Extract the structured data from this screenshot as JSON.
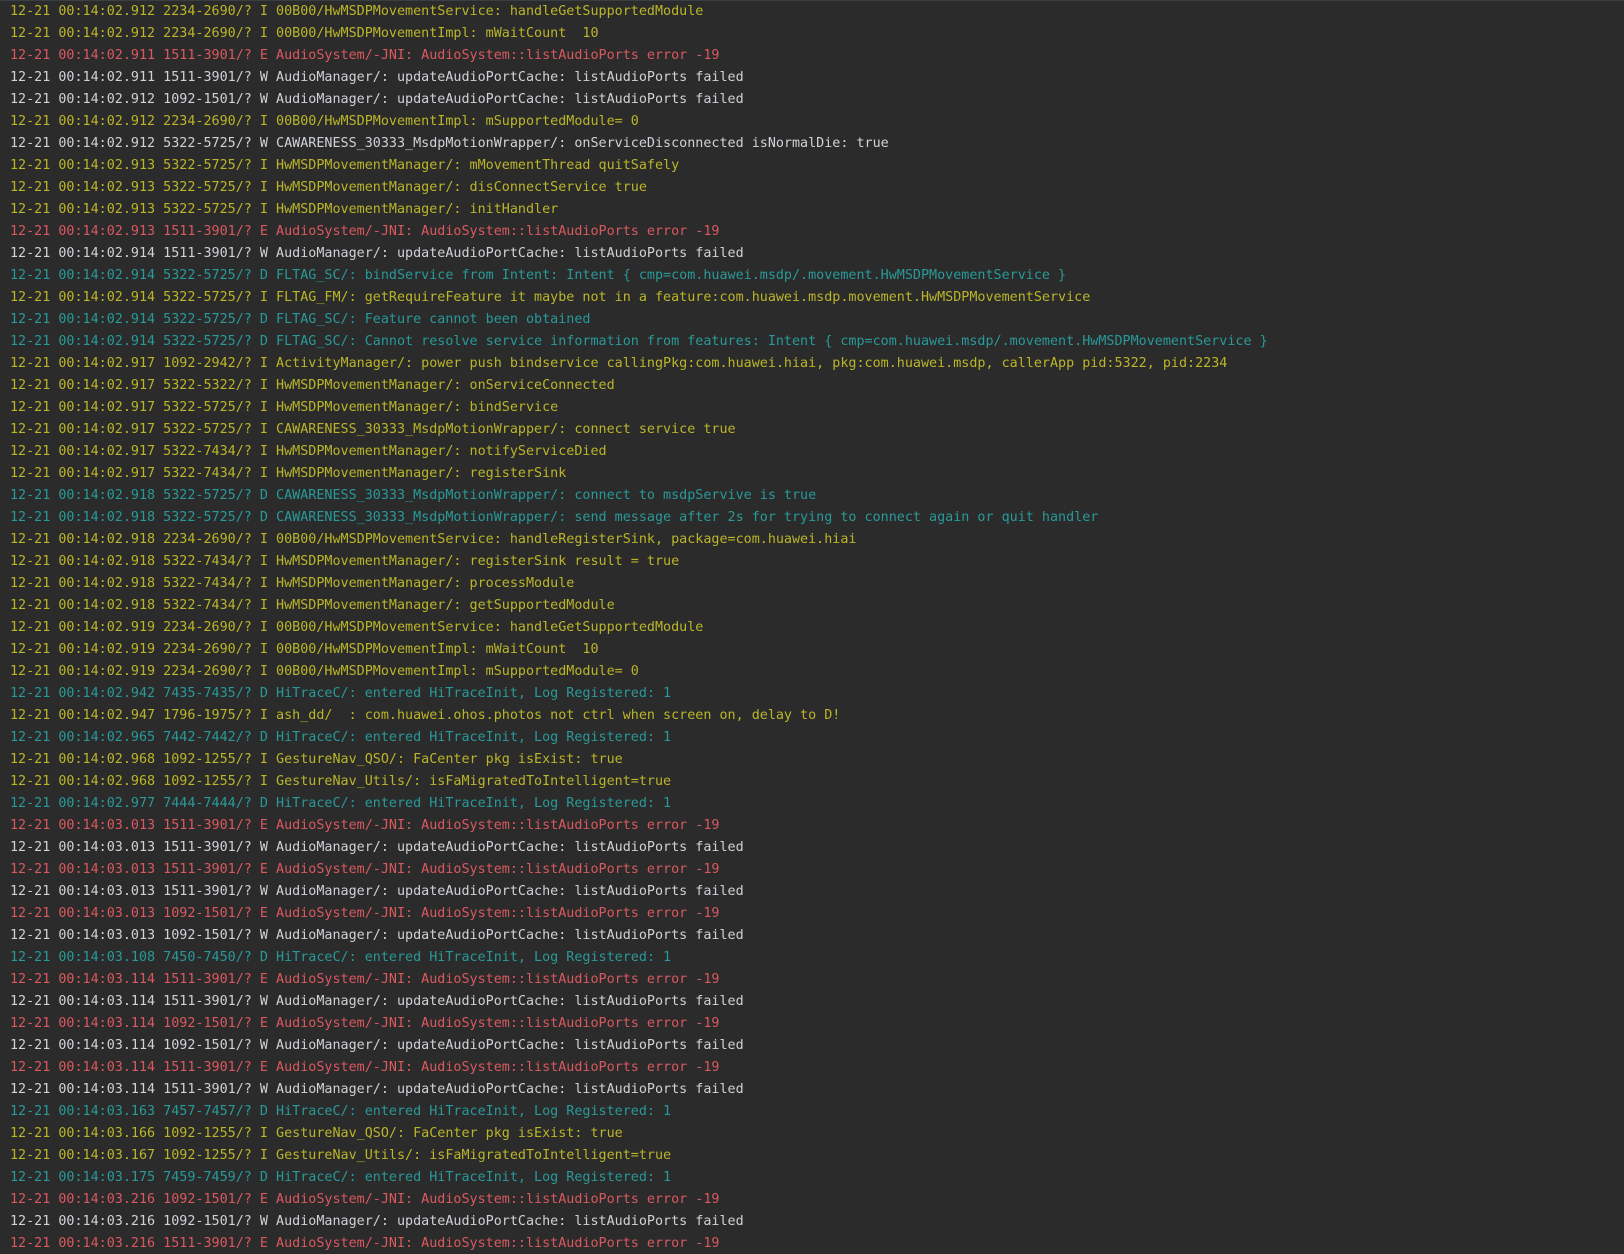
{
  "log": {
    "colors": {
      "I": "#bbb529",
      "E": "#d9595f",
      "W": "#cfd2d6",
      "D": "#299999",
      "background": "#2b2b2b"
    },
    "lines": [
      {
        "level": "I",
        "text": "12-21 00:14:02.912 2234-2690/? I 00B00/HwMSDPMovementService: handleGetSupportedModule"
      },
      {
        "level": "I",
        "text": "12-21 00:14:02.912 2234-2690/? I 00B00/HwMSDPMovementImpl: mWaitCount  10"
      },
      {
        "level": "E",
        "text": "12-21 00:14:02.911 1511-3901/? E AudioSystem/-JNI: AudioSystem::listAudioPorts error -19"
      },
      {
        "level": "W",
        "text": "12-21 00:14:02.911 1511-3901/? W AudioManager/: updateAudioPortCache: listAudioPorts failed"
      },
      {
        "level": "W",
        "text": "12-21 00:14:02.912 1092-1501/? W AudioManager/: updateAudioPortCache: listAudioPorts failed"
      },
      {
        "level": "I",
        "text": "12-21 00:14:02.912 2234-2690/? I 00B00/HwMSDPMovementImpl: mSupportedModule= 0"
      },
      {
        "level": "W",
        "text": "12-21 00:14:02.912 5322-5725/? W CAWARENESS_30333_MsdpMotionWrapper/: onServiceDisconnected isNormalDie: true"
      },
      {
        "level": "I",
        "text": "12-21 00:14:02.913 5322-5725/? I HwMSDPMovementManager/: mMovementThread quitSafely"
      },
      {
        "level": "I",
        "text": "12-21 00:14:02.913 5322-5725/? I HwMSDPMovementManager/: disConnectService true"
      },
      {
        "level": "I",
        "text": "12-21 00:14:02.913 5322-5725/? I HwMSDPMovementManager/: initHandler"
      },
      {
        "level": "E",
        "text": "12-21 00:14:02.913 1511-3901/? E AudioSystem/-JNI: AudioSystem::listAudioPorts error -19"
      },
      {
        "level": "W",
        "text": "12-21 00:14:02.914 1511-3901/? W AudioManager/: updateAudioPortCache: listAudioPorts failed"
      },
      {
        "level": "D",
        "text": "12-21 00:14:02.914 5322-5725/? D FLTAG_SC/: bindService from Intent: Intent { cmp=com.huawei.msdp/.movement.HwMSDPMovementService }"
      },
      {
        "level": "I",
        "text": "12-21 00:14:02.914 5322-5725/? I FLTAG_FM/: getRequireFeature it maybe not in a feature:com.huawei.msdp.movement.HwMSDPMovementService"
      },
      {
        "level": "D",
        "text": "12-21 00:14:02.914 5322-5725/? D FLTAG_SC/: Feature cannot been obtained"
      },
      {
        "level": "D",
        "text": "12-21 00:14:02.914 5322-5725/? D FLTAG_SC/: Cannot resolve service information from features: Intent { cmp=com.huawei.msdp/.movement.HwMSDPMovementService }"
      },
      {
        "level": "I",
        "text": "12-21 00:14:02.917 1092-2942/? I ActivityManager/: power push bindservice callingPkg:com.huawei.hiai, pkg:com.huawei.msdp, callerApp pid:5322, pid:2234"
      },
      {
        "level": "I",
        "text": "12-21 00:14:02.917 5322-5322/? I HwMSDPMovementManager/: onServiceConnected"
      },
      {
        "level": "I",
        "text": "12-21 00:14:02.917 5322-5725/? I HwMSDPMovementManager/: bindService"
      },
      {
        "level": "I",
        "text": "12-21 00:14:02.917 5322-5725/? I CAWARENESS_30333_MsdpMotionWrapper/: connect service true"
      },
      {
        "level": "I",
        "text": "12-21 00:14:02.917 5322-7434/? I HwMSDPMovementManager/: notifyServiceDied"
      },
      {
        "level": "I",
        "text": "12-21 00:14:02.917 5322-7434/? I HwMSDPMovementManager/: registerSink"
      },
      {
        "level": "D",
        "text": "12-21 00:14:02.918 5322-5725/? D CAWARENESS_30333_MsdpMotionWrapper/: connect to msdpServive is true"
      },
      {
        "level": "D",
        "text": "12-21 00:14:02.918 5322-5725/? D CAWARENESS_30333_MsdpMotionWrapper/: send message after 2s for trying to connect again or quit handler"
      },
      {
        "level": "I",
        "text": "12-21 00:14:02.918 2234-2690/? I 00B00/HwMSDPMovementService: handleRegisterSink, package=com.huawei.hiai"
      },
      {
        "level": "I",
        "text": "12-21 00:14:02.918 5322-7434/? I HwMSDPMovementManager/: registerSink result = true"
      },
      {
        "level": "I",
        "text": "12-21 00:14:02.918 5322-7434/? I HwMSDPMovementManager/: processModule"
      },
      {
        "level": "I",
        "text": "12-21 00:14:02.918 5322-7434/? I HwMSDPMovementManager/: getSupportedModule"
      },
      {
        "level": "I",
        "text": "12-21 00:14:02.919 2234-2690/? I 00B00/HwMSDPMovementService: handleGetSupportedModule"
      },
      {
        "level": "I",
        "text": "12-21 00:14:02.919 2234-2690/? I 00B00/HwMSDPMovementImpl: mWaitCount  10"
      },
      {
        "level": "I",
        "text": "12-21 00:14:02.919 2234-2690/? I 00B00/HwMSDPMovementImpl: mSupportedModule= 0"
      },
      {
        "level": "D",
        "text": "12-21 00:14:02.942 7435-7435/? D HiTraceC/: entered HiTraceInit, Log Registered: 1"
      },
      {
        "level": "I",
        "text": "12-21 00:14:02.947 1796-1975/? I ash_dd/  : com.huawei.ohos.photos not ctrl when screen on, delay to D!"
      },
      {
        "level": "D",
        "text": "12-21 00:14:02.965 7442-7442/? D HiTraceC/: entered HiTraceInit, Log Registered: 1"
      },
      {
        "level": "I",
        "text": "12-21 00:14:02.968 1092-1255/? I GestureNav_QSO/: FaCenter pkg isExist: true"
      },
      {
        "level": "I",
        "text": "12-21 00:14:02.968 1092-1255/? I GestureNav_Utils/: isFaMigratedToIntelligent=true"
      },
      {
        "level": "D",
        "text": "12-21 00:14:02.977 7444-7444/? D HiTraceC/: entered HiTraceInit, Log Registered: 1"
      },
      {
        "level": "E",
        "text": "12-21 00:14:03.013 1511-3901/? E AudioSystem/-JNI: AudioSystem::listAudioPorts error -19"
      },
      {
        "level": "W",
        "text": "12-21 00:14:03.013 1511-3901/? W AudioManager/: updateAudioPortCache: listAudioPorts failed"
      },
      {
        "level": "E",
        "text": "12-21 00:14:03.013 1511-3901/? E AudioSystem/-JNI: AudioSystem::listAudioPorts error -19"
      },
      {
        "level": "W",
        "text": "12-21 00:14:03.013 1511-3901/? W AudioManager/: updateAudioPortCache: listAudioPorts failed"
      },
      {
        "level": "E",
        "text": "12-21 00:14:03.013 1092-1501/? E AudioSystem/-JNI: AudioSystem::listAudioPorts error -19"
      },
      {
        "level": "W",
        "text": "12-21 00:14:03.013 1092-1501/? W AudioManager/: updateAudioPortCache: listAudioPorts failed"
      },
      {
        "level": "D",
        "text": "12-21 00:14:03.108 7450-7450/? D HiTraceC/: entered HiTraceInit, Log Registered: 1"
      },
      {
        "level": "E",
        "text": "12-21 00:14:03.114 1511-3901/? E AudioSystem/-JNI: AudioSystem::listAudioPorts error -19"
      },
      {
        "level": "W",
        "text": "12-21 00:14:03.114 1511-3901/? W AudioManager/: updateAudioPortCache: listAudioPorts failed"
      },
      {
        "level": "E",
        "text": "12-21 00:14:03.114 1092-1501/? E AudioSystem/-JNI: AudioSystem::listAudioPorts error -19"
      },
      {
        "level": "W",
        "text": "12-21 00:14:03.114 1092-1501/? W AudioManager/: updateAudioPortCache: listAudioPorts failed"
      },
      {
        "level": "E",
        "text": "12-21 00:14:03.114 1511-3901/? E AudioSystem/-JNI: AudioSystem::listAudioPorts error -19"
      },
      {
        "level": "W",
        "text": "12-21 00:14:03.114 1511-3901/? W AudioManager/: updateAudioPortCache: listAudioPorts failed"
      },
      {
        "level": "D",
        "text": "12-21 00:14:03.163 7457-7457/? D HiTraceC/: entered HiTraceInit, Log Registered: 1"
      },
      {
        "level": "I",
        "text": "12-21 00:14:03.166 1092-1255/? I GestureNav_QSO/: FaCenter pkg isExist: true"
      },
      {
        "level": "I",
        "text": "12-21 00:14:03.167 1092-1255/? I GestureNav_Utils/: isFaMigratedToIntelligent=true"
      },
      {
        "level": "D",
        "text": "12-21 00:14:03.175 7459-7459/? D HiTraceC/: entered HiTraceInit, Log Registered: 1"
      },
      {
        "level": "E",
        "text": "12-21 00:14:03.216 1092-1501/? E AudioSystem/-JNI: AudioSystem::listAudioPorts error -19"
      },
      {
        "level": "W",
        "text": "12-21 00:14:03.216 1092-1501/? W AudioManager/: updateAudioPortCache: listAudioPorts failed"
      },
      {
        "level": "E",
        "text": "12-21 00:14:03.216 1511-3901/? E AudioSystem/-JNI: AudioSystem::listAudioPorts error -19"
      }
    ]
  }
}
